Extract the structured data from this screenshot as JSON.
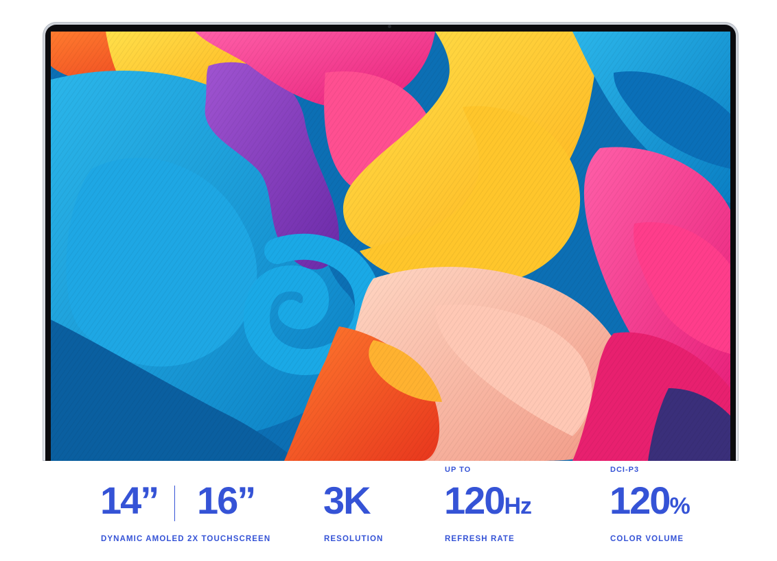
{
  "colors": {
    "accent": "#3553d6",
    "background": "#ffffff",
    "bezel": "#d6d9df"
  },
  "hero": {
    "image": "abstract-colorful-swirl-wallpaper"
  },
  "specs": {
    "size": {
      "value_a": "14”",
      "value_b": "16”",
      "caption": "DYNAMIC AMOLED 2X TOUCHSCREEN"
    },
    "resolution": {
      "value": "3K",
      "caption": "RESOLUTION"
    },
    "refresh": {
      "kicker": "UP TO",
      "value": "120",
      "unit": "Hz",
      "caption": "REFRESH RATE"
    },
    "color": {
      "kicker": "DCI-P3",
      "value": "120",
      "unit": "%",
      "caption": "COLOR VOLUME"
    }
  }
}
